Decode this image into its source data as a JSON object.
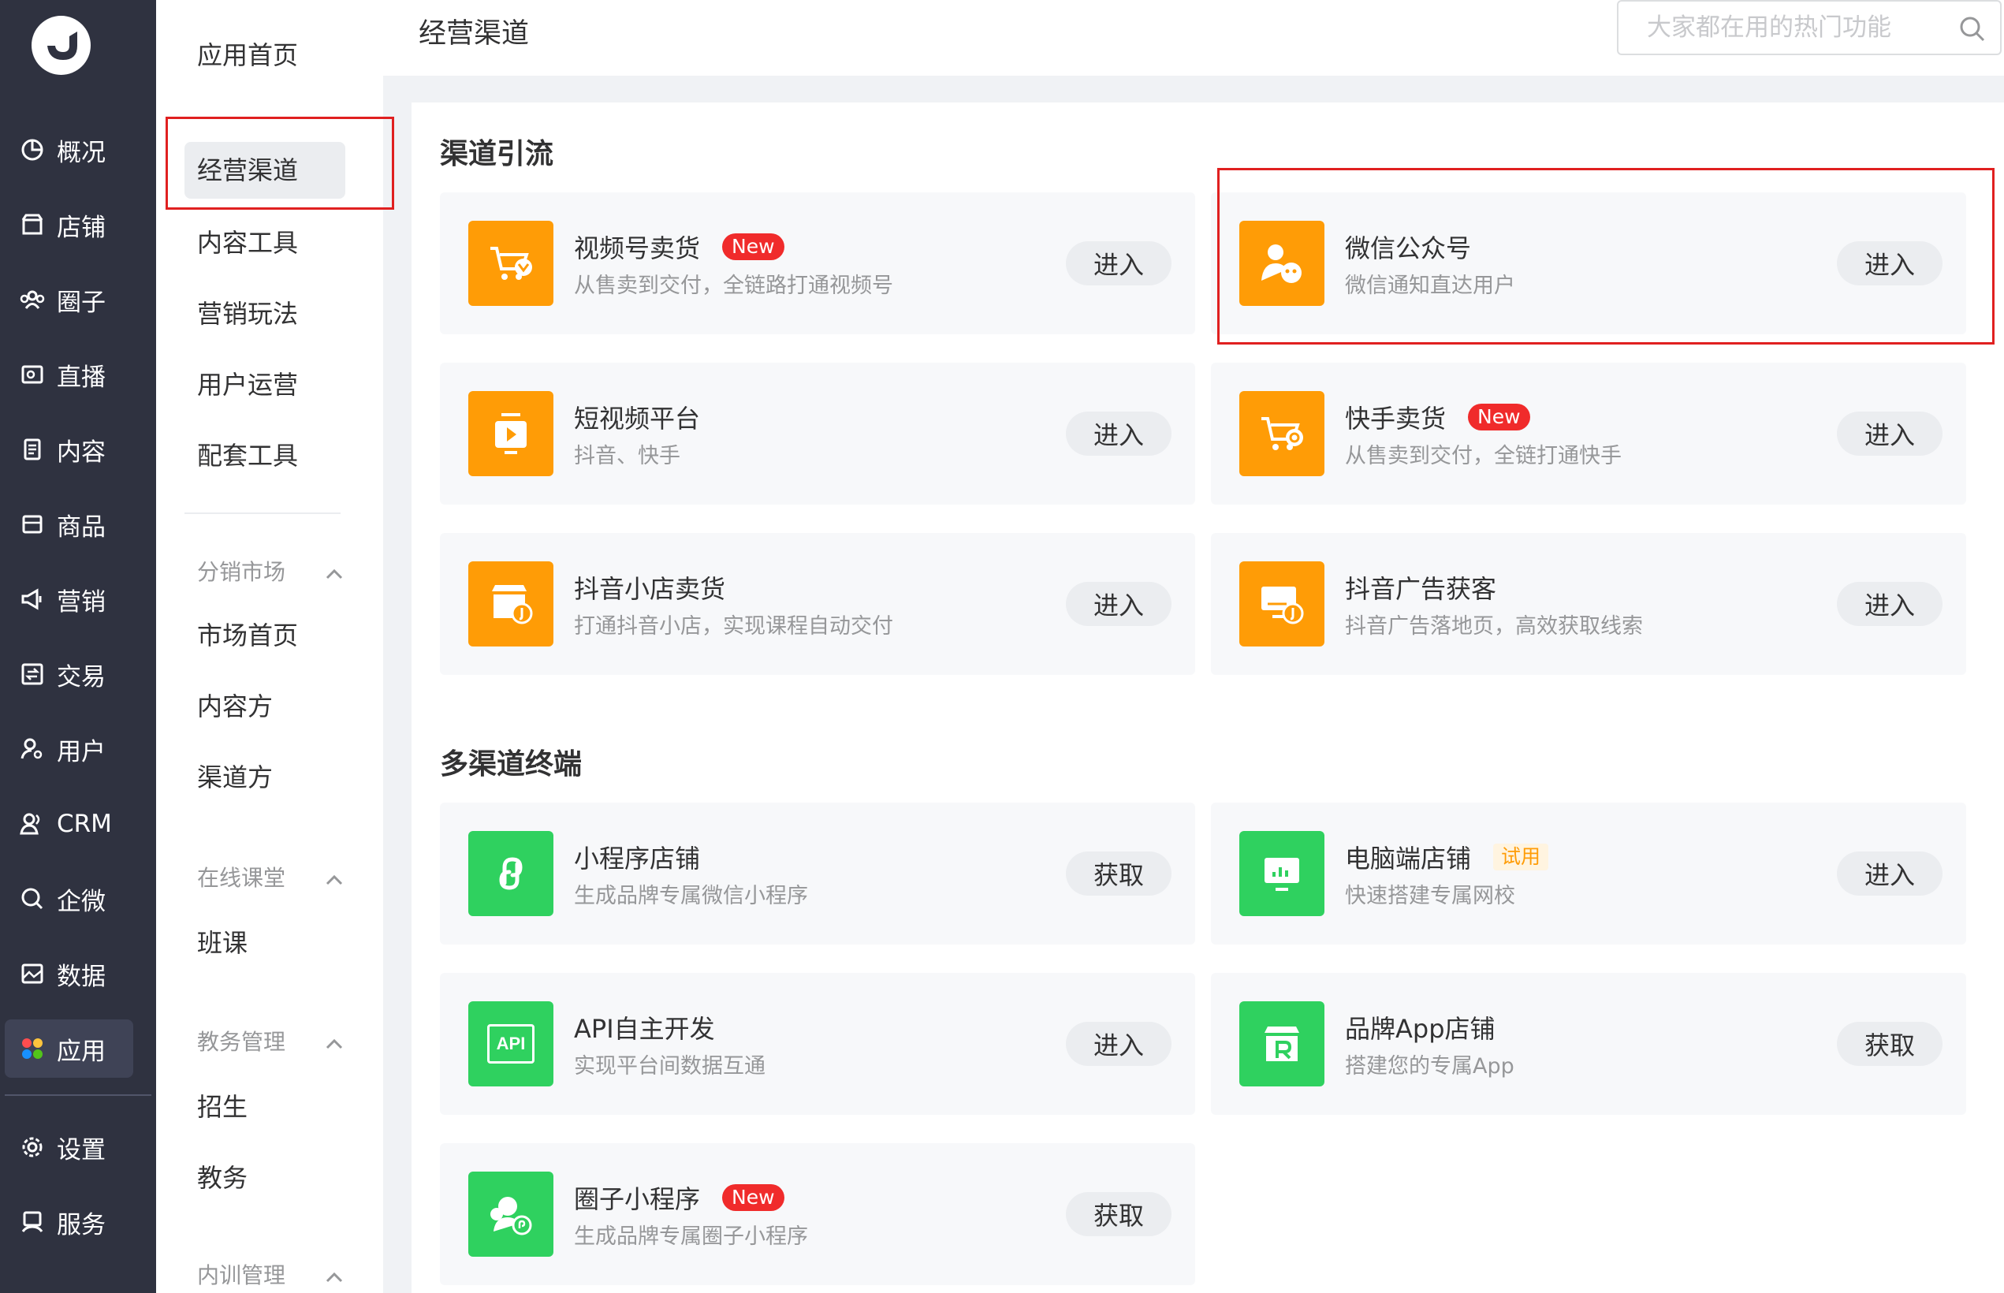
{
  "nav": {
    "items": [
      {
        "label": "概况",
        "icon": "pie-chart-icon"
      },
      {
        "label": "店铺",
        "icon": "shop-icon"
      },
      {
        "label": "圈子",
        "icon": "users-group-icon"
      },
      {
        "label": "直播",
        "icon": "live-icon"
      },
      {
        "label": "内容",
        "icon": "document-icon"
      },
      {
        "label": "商品",
        "icon": "box-icon"
      },
      {
        "label": "营销",
        "icon": "megaphone-icon"
      },
      {
        "label": "交易",
        "icon": "exchange-icon"
      },
      {
        "label": "用户",
        "icon": "user-gear-icon"
      },
      {
        "label": "CRM",
        "icon": "crm-users-icon"
      },
      {
        "label": "企微",
        "icon": "wecom-icon"
      },
      {
        "label": "数据",
        "icon": "data-image-icon"
      },
      {
        "label": "应用",
        "icon": "apps-icon"
      },
      {
        "label": "设置",
        "icon": "gear-icon"
      },
      {
        "label": "服务",
        "icon": "service-icon"
      }
    ]
  },
  "subnav": {
    "home": "应用首页",
    "items": [
      "经营渠道",
      "内容工具",
      "营销玩法",
      "用户运营",
      "配套工具"
    ],
    "groups": [
      {
        "title": "分销市场",
        "items": [
          "市场首页",
          "内容方",
          "渠道方"
        ]
      },
      {
        "title": "在线课堂",
        "items": [
          "班课"
        ]
      },
      {
        "title": "教务管理",
        "items": [
          "招生",
          "教务"
        ]
      },
      {
        "title": "内训管理",
        "items": []
      }
    ]
  },
  "header": {
    "title": "经营渠道",
    "search_placeholder": "大家都在用的热门功能"
  },
  "sections": [
    {
      "title": "渠道引流",
      "cards": [
        {
          "title": "视频号卖货",
          "badge": "New",
          "desc": "从售卖到交付，全链路打通视频号",
          "button": "进入"
        },
        {
          "title": "微信公众号",
          "desc": "微信通知直达用户",
          "button": "进入"
        },
        {
          "title": "短视频平台",
          "desc": "抖音、快手",
          "button": "进入"
        },
        {
          "title": "快手卖货",
          "badge": "New",
          "desc": "从售卖到交付，全链打通快手",
          "button": "进入"
        },
        {
          "title": "抖音小店卖货",
          "desc": "打通抖音小店，实现课程自动交付",
          "button": "进入"
        },
        {
          "title": "抖音广告获客",
          "desc": "抖音广告落地页，高效获取线索",
          "button": "进入"
        }
      ]
    },
    {
      "title": "多渠道终端",
      "cards": [
        {
          "title": "小程序店铺",
          "desc": "生成品牌专属微信小程序",
          "button": "获取"
        },
        {
          "title": "电脑端店铺",
          "badge": "试用",
          "desc": "快速搭建专属网校",
          "button": "进入"
        },
        {
          "title": "API自主开发",
          "icon_text": "API",
          "desc": "实现平台间数据互通",
          "button": "进入"
        },
        {
          "title": "品牌App店铺",
          "desc": "搭建您的专属App",
          "button": "获取"
        },
        {
          "title": "圈子小程序",
          "badge": "New",
          "desc": "生成品牌专属圈子小程序",
          "button": "获取"
        }
      ]
    }
  ],
  "colors": {
    "accent_orange": "#ff9c06",
    "accent_green": "#2fd15f",
    "badge_red": "#f02b2b",
    "nav_bg": "#2f3240",
    "highlight_red": "#e02020"
  }
}
